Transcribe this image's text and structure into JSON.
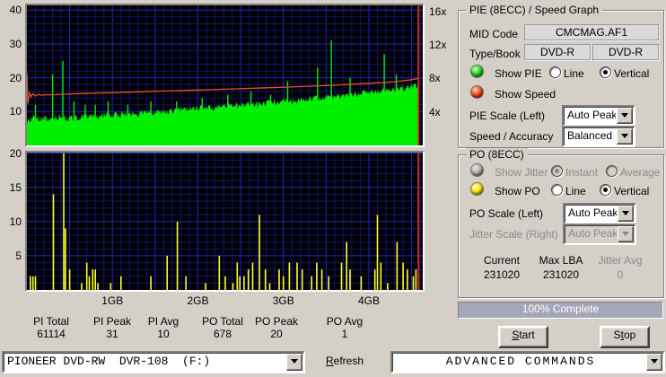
{
  "colors": {
    "dialog_bg": "#d4d0c8",
    "graph_bg": "#000000",
    "grid_major": "#2626c8",
    "grid_minor": "#14146e",
    "pie_green": "#00f000",
    "po_yellow": "#ffff29",
    "speed_line": "#e6512d",
    "scan_end_line": "#d22816",
    "progress_fill": "#a6a6ba",
    "led_green": "#22d622",
    "led_red": "#ee4f22",
    "led_yellow": "#ffe800",
    "led_gray": "#b0b0b0"
  },
  "pie_panel": {
    "title": "PIE (8ECC) / Speed Graph",
    "mid_code_label": "MID Code",
    "mid_code_value": "CMCMAG.AF1",
    "type_book_label": "Type/Book",
    "type_value": "DVD-R",
    "book_value": "DVD-R",
    "show_pie_label": "Show PIE",
    "show_speed_label": "Show Speed",
    "line_label": "Line",
    "vertical_label": "Vertical",
    "pie_scale_label": "PIE Scale (Left)",
    "pie_scale_value": "Auto Peak",
    "speed_accuracy_label": "Speed / Accuracy",
    "speed_accuracy_value": "Balanced"
  },
  "po_panel": {
    "title": "PO (8ECC)",
    "show_jitter_label": "Show Jitter",
    "instant_label": "Instant",
    "average_label": "Average",
    "show_po_label": "Show PO",
    "line_label": "Line",
    "vertical_label": "Vertical",
    "po_scale_label": "PO Scale (Left)",
    "po_scale_value": "Auto Peak",
    "jitter_scale_label": "Jitter Scale (Right)",
    "jitter_scale_value": "Auto Peak",
    "current_label": "Current",
    "current_value": "231020",
    "max_lba_label": "Max LBA",
    "max_lba_value": "231020",
    "jitter_avg_label": "Jitter Avg",
    "jitter_avg_value": "0"
  },
  "progress": {
    "label": "100% Complete",
    "percent": 100
  },
  "buttons": {
    "start": "Start",
    "stop": "Stop"
  },
  "stats": {
    "items": [
      {
        "label": "PI Total",
        "value": "61114"
      },
      {
        "label": "PI Peak",
        "value": "31"
      },
      {
        "label": "PI Avg",
        "value": "10"
      },
      {
        "label": "PO Total",
        "value": "678"
      },
      {
        "label": "PO Peak",
        "value": "20"
      },
      {
        "label": "PO Avg",
        "value": "1"
      }
    ]
  },
  "drive_bar": {
    "drive": "PIONEER DVD-RW  DVR-108  (F:)",
    "refresh": "Refresh",
    "commands": "ADVANCED COMMANDS"
  },
  "chart_data": [
    {
      "type": "area",
      "title": "PIE (8ECC) / Speed Graph",
      "x_unit": "GB",
      "xlim": [
        0,
        4.63
      ],
      "scan_end_gb": 4.58,
      "x_tick_values": [
        1,
        2,
        3,
        4
      ],
      "x_tick_labels": [
        "1GB",
        "2GB",
        "3GB",
        "4GB"
      ],
      "left_axis": {
        "name": "PIE",
        "ylim": [
          0,
          41.4
        ],
        "ticks": [
          10,
          20,
          30,
          40
        ],
        "minor_step": 2,
        "major_step": 10
      },
      "right_axis": {
        "name": "Speed",
        "ylim": [
          0,
          16.73
        ],
        "ticks": [
          4,
          8,
          12,
          16
        ],
        "tick_suffix": "x"
      },
      "grid": {
        "x_minor_gb": 0.1,
        "x_major_gb": 0.5
      },
      "pie_base": [
        [
          0.0,
          7.5
        ],
        [
          0.1,
          7.8
        ],
        [
          0.2,
          7.6
        ],
        [
          0.3,
          8.2
        ],
        [
          0.4,
          8.5
        ],
        [
          0.5,
          8.0
        ],
        [
          0.6,
          8.3
        ],
        [
          0.7,
          8.6
        ],
        [
          0.8,
          8.4
        ],
        [
          0.9,
          9.0
        ],
        [
          1.0,
          9.2
        ],
        [
          1.1,
          9.0
        ],
        [
          1.2,
          9.4
        ],
        [
          1.3,
          9.3
        ],
        [
          1.4,
          9.7
        ],
        [
          1.5,
          10.0
        ],
        [
          1.6,
          10.2
        ],
        [
          1.7,
          10.0
        ],
        [
          1.8,
          10.5
        ],
        [
          1.9,
          10.8
        ],
        [
          2.0,
          11.0
        ],
        [
          2.1,
          11.2
        ],
        [
          2.2,
          11.0
        ],
        [
          2.3,
          11.5
        ],
        [
          2.4,
          11.8
        ],
        [
          2.5,
          12.0
        ],
        [
          2.6,
          12.3
        ],
        [
          2.7,
          12.0
        ],
        [
          2.8,
          12.5
        ],
        [
          2.9,
          13.0
        ],
        [
          3.0,
          13.2
        ],
        [
          3.1,
          13.0
        ],
        [
          3.2,
          13.5
        ],
        [
          3.3,
          13.8
        ],
        [
          3.4,
          14.0
        ],
        [
          3.5,
          14.3
        ],
        [
          3.6,
          14.6
        ],
        [
          3.7,
          14.4
        ],
        [
          3.8,
          15.0
        ],
        [
          3.9,
          15.3
        ],
        [
          4.0,
          15.6
        ],
        [
          4.1,
          16.0
        ],
        [
          4.2,
          16.3
        ],
        [
          4.3,
          16.6
        ],
        [
          4.4,
          17.0
        ],
        [
          4.5,
          17.5
        ],
        [
          4.58,
          18.0
        ]
      ],
      "pie_spikes": [
        [
          0.1,
          12
        ],
        [
          0.3,
          21
        ],
        [
          0.42,
          25
        ],
        [
          0.55,
          13
        ],
        [
          0.68,
          12
        ],
        [
          0.8,
          12
        ],
        [
          0.95,
          13
        ],
        [
          1.18,
          12
        ],
        [
          1.45,
          13
        ],
        [
          1.75,
          13
        ],
        [
          2.05,
          14
        ],
        [
          2.35,
          15
        ],
        [
          2.62,
          16
        ],
        [
          2.85,
          15
        ],
        [
          3.05,
          19
        ],
        [
          3.4,
          23
        ],
        [
          3.56,
          31
        ],
        [
          3.78,
          20
        ],
        [
          4.18,
          27
        ],
        [
          4.32,
          21
        ]
      ],
      "speed_line": [
        [
          0.0,
          8.6
        ],
        [
          0.01,
          5.0
        ],
        [
          0.03,
          6.3
        ],
        [
          0.05,
          5.8
        ],
        [
          0.07,
          6.2
        ],
        [
          0.1,
          5.9
        ],
        [
          0.13,
          6.1
        ],
        [
          0.16,
          6.0
        ],
        [
          0.2,
          6.05
        ],
        [
          0.3,
          6.05
        ],
        [
          0.5,
          6.15
        ],
        [
          0.8,
          6.25
        ],
        [
          1.0,
          6.3
        ],
        [
          1.3,
          6.4
        ],
        [
          1.6,
          6.5
        ],
        [
          2.0,
          6.62
        ],
        [
          2.4,
          6.75
        ],
        [
          2.8,
          6.88
        ],
        [
          3.2,
          7.02
        ],
        [
          3.6,
          7.2
        ],
        [
          4.0,
          7.42
        ],
        [
          4.3,
          7.6
        ],
        [
          4.5,
          7.85
        ],
        [
          4.58,
          8.0
        ]
      ]
    },
    {
      "type": "bar",
      "title": "PO (8ECC)",
      "x_unit": "GB",
      "xlim": [
        0,
        4.63
      ],
      "scan_end_gb": 4.58,
      "x_tick_values": [
        1,
        2,
        3,
        4
      ],
      "x_tick_labels": [
        "1GB",
        "2GB",
        "3GB",
        "4GB"
      ],
      "left_axis": {
        "name": "PO",
        "ylim": [
          0,
          20.1
        ],
        "ticks": [
          5,
          10,
          15,
          20
        ],
        "minor_step": 1,
        "major_step": 5
      },
      "grid": {
        "x_minor_gb": 0.1,
        "x_major_gb": 0.5
      },
      "po_bars": [
        [
          0.04,
          2
        ],
        [
          0.07,
          2
        ],
        [
          0.1,
          2
        ],
        [
          0.31,
          14
        ],
        [
          0.43,
          20
        ],
        [
          0.45,
          9
        ],
        [
          0.5,
          3
        ],
        [
          0.64,
          1
        ],
        [
          0.7,
          4
        ],
        [
          0.73,
          2
        ],
        [
          0.77,
          3
        ],
        [
          0.8,
          3
        ],
        [
          0.83,
          1
        ],
        [
          0.98,
          1
        ],
        [
          1.1,
          2
        ],
        [
          1.45,
          2
        ],
        [
          1.64,
          5
        ],
        [
          1.76,
          10
        ],
        [
          1.86,
          2
        ],
        [
          2.09,
          1
        ],
        [
          2.25,
          5
        ],
        [
          2.32,
          2
        ],
        [
          2.41,
          1
        ],
        [
          2.46,
          4
        ],
        [
          2.49,
          2
        ],
        [
          2.54,
          2
        ],
        [
          2.59,
          3
        ],
        [
          2.64,
          4
        ],
        [
          2.72,
          11
        ],
        [
          2.79,
          3
        ],
        [
          2.84,
          1
        ],
        [
          2.95,
          3
        ],
        [
          3.0,
          2
        ],
        [
          3.07,
          4
        ],
        [
          3.16,
          4
        ],
        [
          3.22,
          3
        ],
        [
          3.33,
          2
        ],
        [
          3.39,
          4
        ],
        [
          3.45,
          3
        ],
        [
          3.53,
          2
        ],
        [
          3.68,
          4
        ],
        [
          3.74,
          7
        ],
        [
          3.78,
          3
        ],
        [
          3.91,
          2
        ],
        [
          4.07,
          3
        ],
        [
          4.1,
          11
        ],
        [
          4.14,
          4
        ],
        [
          4.22,
          1
        ],
        [
          4.33,
          7
        ],
        [
          4.4,
          4
        ],
        [
          4.45,
          3
        ],
        [
          4.52,
          2
        ],
        [
          4.55,
          3
        ]
      ]
    }
  ]
}
